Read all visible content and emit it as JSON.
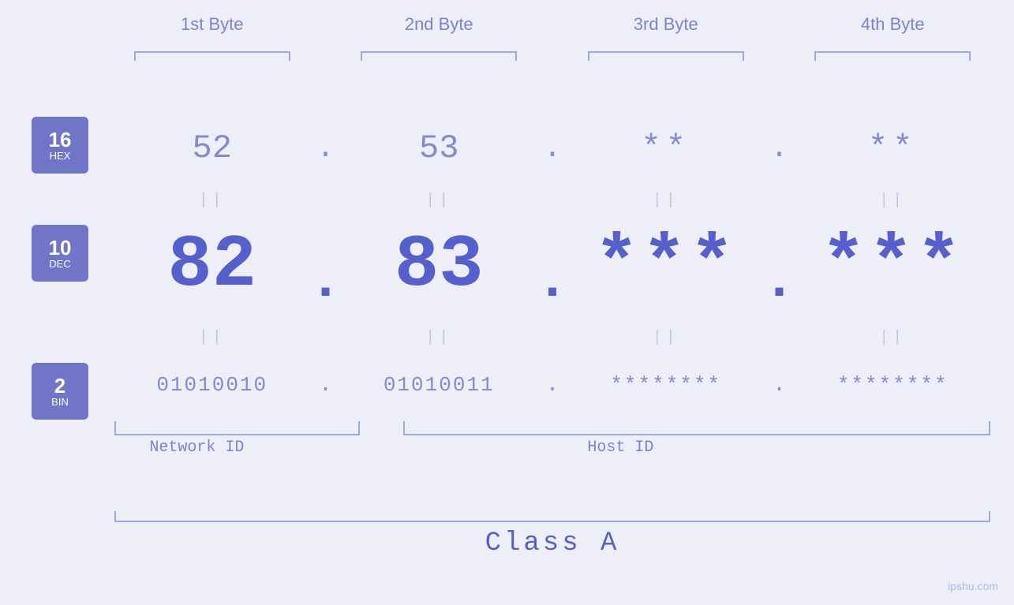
{
  "page": {
    "background_color": "#eeeef8",
    "watermark": "ipshu.com"
  },
  "byte_labels": {
    "b1": "1st Byte",
    "b2": "2nd Byte",
    "b3": "3rd Byte",
    "b4": "4th Byte"
  },
  "badges": {
    "hex": {
      "num": "16",
      "label": "HEX"
    },
    "dec": {
      "num": "10",
      "label": "DEC"
    },
    "bin": {
      "num": "2",
      "label": "BIN"
    }
  },
  "hex_row": {
    "b1": "52",
    "b2": "53",
    "b3": "**",
    "b4": "**",
    "dot": "."
  },
  "dec_row": {
    "b1": "82",
    "b2": "83",
    "b3": "***",
    "b4": "***",
    "dot": "."
  },
  "bin_row": {
    "b1": "01010010",
    "b2": "01010011",
    "b3": "********",
    "b4": "********",
    "dot": "."
  },
  "equals": "||",
  "labels": {
    "network_id": "Network ID",
    "host_id": "Host ID",
    "class": "Class A"
  }
}
